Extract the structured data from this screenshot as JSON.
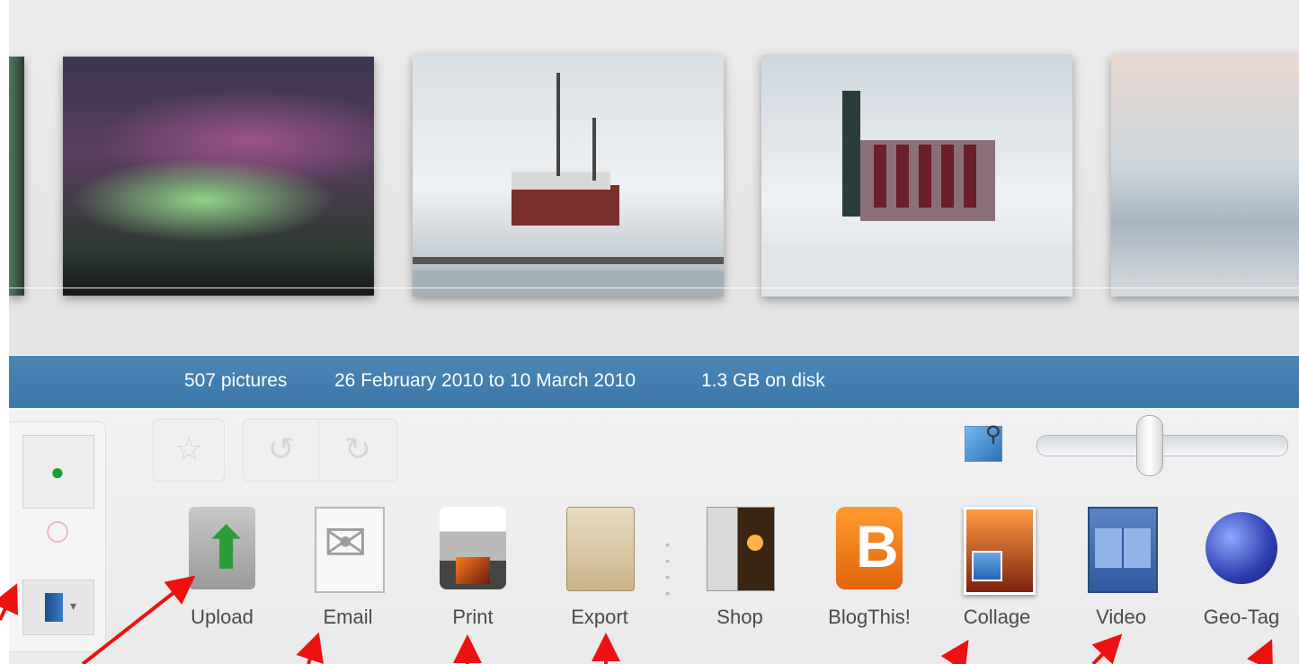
{
  "info_bar": {
    "count": "507 pictures",
    "dates": "26 February 2010 to 10 March 2010",
    "size": "1.3 GB on disk"
  },
  "toolbar": {
    "items": [
      {
        "label": "Upload",
        "icon": "upload-icon"
      },
      {
        "label": "Email",
        "icon": "email-icon"
      },
      {
        "label": "Print",
        "icon": "printer-icon"
      },
      {
        "label": "Export",
        "icon": "folder-icon"
      },
      {
        "label": "Shop",
        "icon": "photobook-icon"
      },
      {
        "label": "BlogThis!",
        "icon": "blogger-icon"
      },
      {
        "label": "Collage",
        "icon": "collage-icon"
      },
      {
        "label": "Video",
        "icon": "film-icon"
      },
      {
        "label": "Geo-Tag",
        "icon": "globe-icon"
      }
    ]
  },
  "zoom_slider": {
    "level": 0.45
  },
  "colors": {
    "info_bar": "#3f7bad",
    "arrow": "#ee1111",
    "label_text": "#4a4a4a"
  }
}
